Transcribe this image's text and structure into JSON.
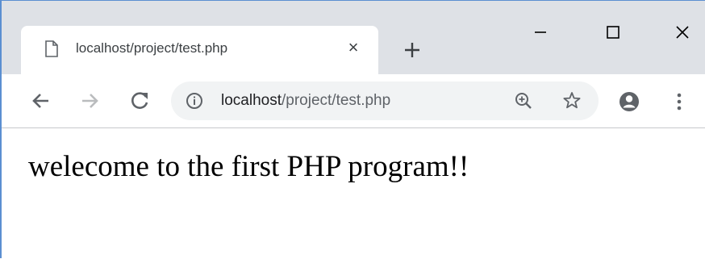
{
  "tab": {
    "title": "localhost/project/test.php",
    "close_glyph": "×",
    "icon": "page-icon"
  },
  "toolbar": {
    "url_host": "localhost",
    "url_path": "/project/test.php",
    "icons": [
      "back-arrow-icon",
      "forward-arrow-icon",
      "reload-icon",
      "info-icon",
      "zoom-icon",
      "star-icon",
      "account-icon",
      "menu-icon"
    ]
  },
  "window_controls": [
    "minimize-icon",
    "maximize-icon",
    "close-icon"
  ],
  "page": {
    "text": "welecome to the first PHP program!!"
  },
  "colors": {
    "frame": "#dee1e6",
    "window_border": "#5b8fd1",
    "omnibox": "#f1f3f4",
    "icon": "#5f6368",
    "disabled_icon": "#babcbe"
  }
}
